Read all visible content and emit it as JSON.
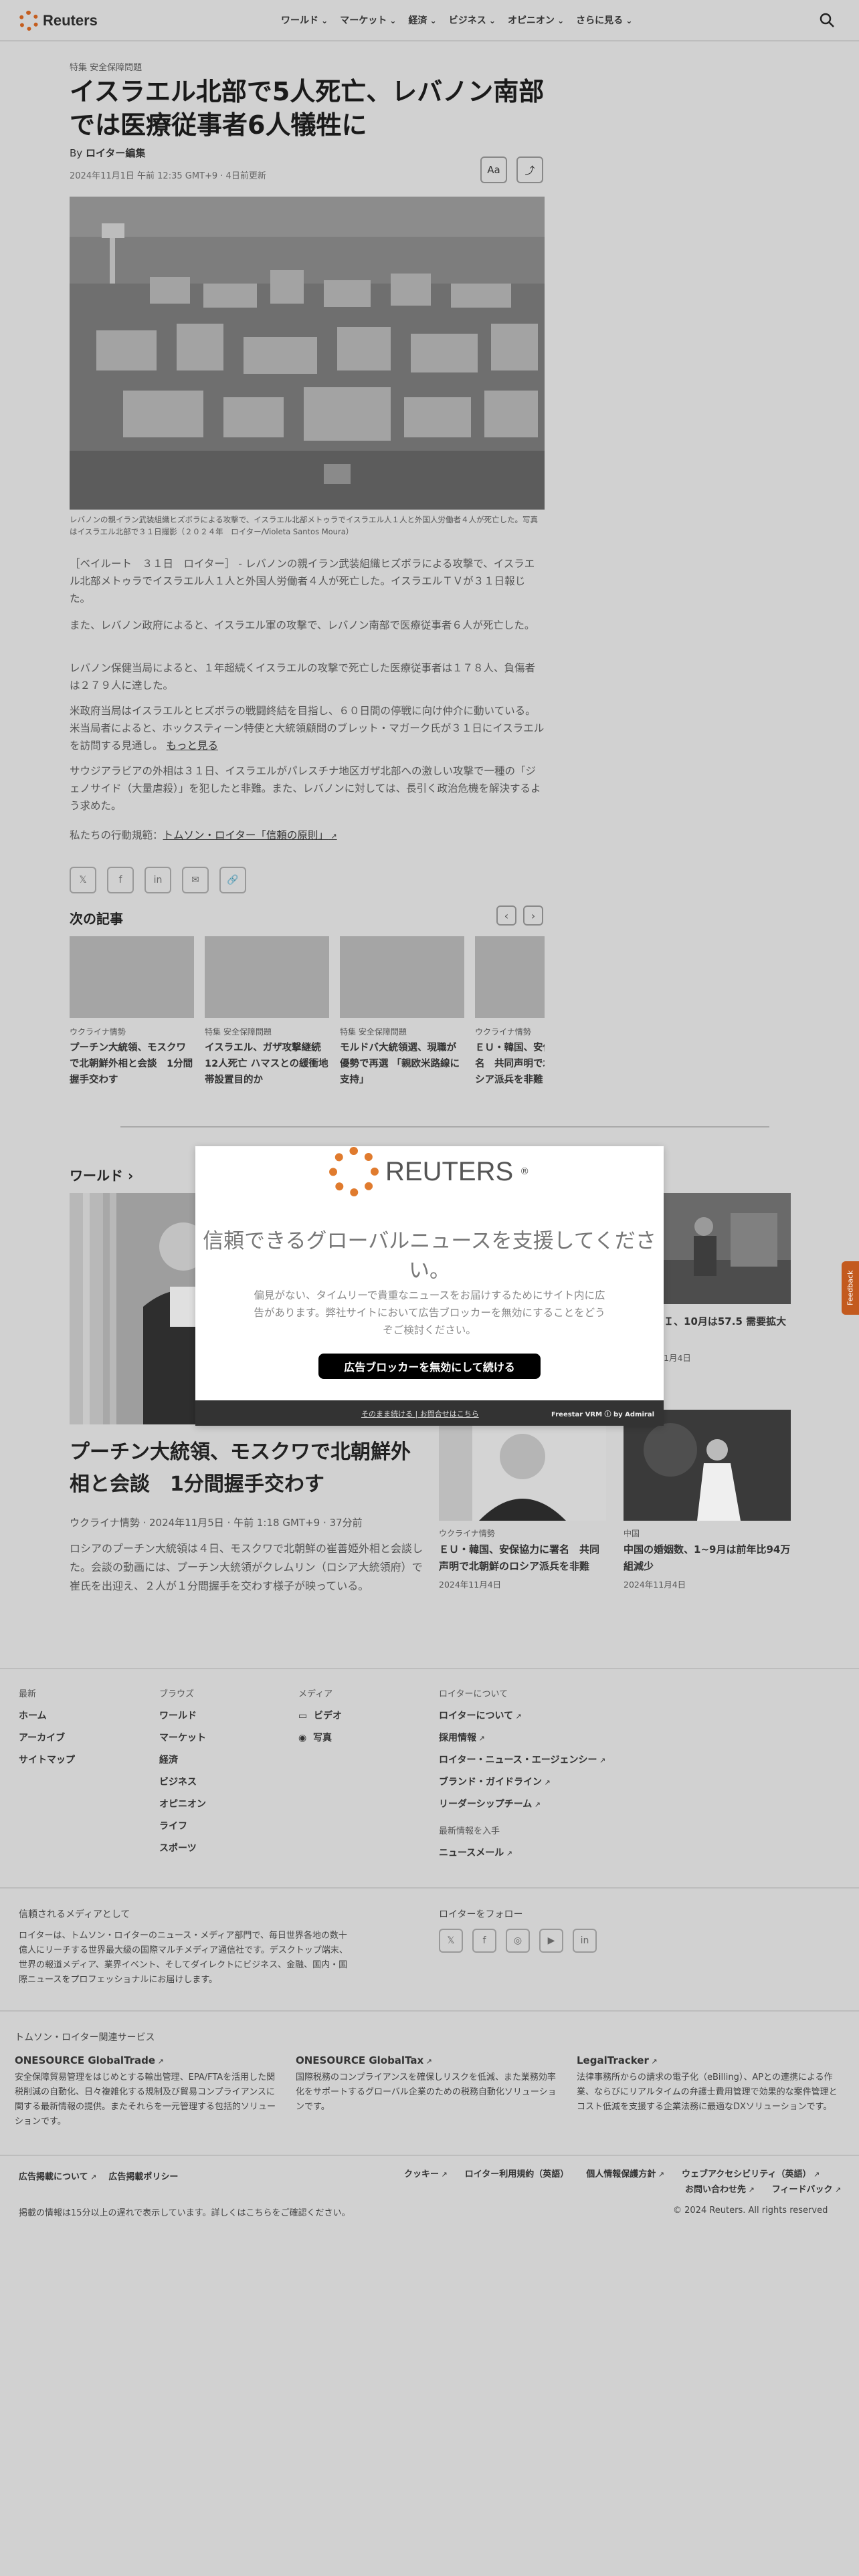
{
  "header": {
    "logo_text": "Reuters",
    "nav": [
      "ワールド",
      "マーケット",
      "経済",
      "ビジネス",
      "オピニオン",
      "さらに見る"
    ]
  },
  "article": {
    "kicker": "特集 安全保障問題",
    "title": "イスラエル北部で5人死亡、レバノン南部では医療従事者6人犠牲に",
    "byline_prefix": "By ",
    "byline_author": "ロイター編集",
    "date": "2024年11月1日 午前 12:35 GMT+9 · 4日前更新",
    "text_size_label": "Aa",
    "caption": "レバノンの親イラン武装組織ヒズボラによる攻撃で、イスラエル北部メトゥラでイスラエル人１人と外国人労働者４人が死亡した。写真はイスラエル北部で３１日撮影（２０２４年　ロイター/Violeta Santos Moura）",
    "paragraphs": [
      "［ベイルート　３１日　ロイター］ - レバノンの親イラン武装組織ヒズボラによる攻撃で、イスラエル北部メトゥラでイスラエル人１人と外国人労働者４人が死亡した。イスラエルＴＶが３１日報じた。",
      "また、レバノン政府によると、イスラエル軍の攻撃で、レバノン南部で医療従事者６人が死亡した。",
      "レバノン保健当局によると、１年超続くイスラエルの攻撃で死亡した医療従事者は１７８人、負傷者は２７９人に達した。",
      "米政府当局はイスラエルとヒズボラの戦闘終結を目指し、６０日間の停戦に向け仲介に動いている。米当局者によると、ホックスティーン特使と大統領顧問のブレット・マガーク氏が３１日にイスラエルを訪問する見通し。",
      "サウジアラビアの外相は３１日、イスラエルがパレスチナ地区ガザ北部への激しい攻撃で一種の「ジェノサイド（大量虐殺）」を犯したと非難。また、レバノンに対しては、長引く政治危機を解決するよう求めた。"
    ],
    "read_more": "もっと見る",
    "principles_prefix": "私たちの行動規範：",
    "principles_link": "トムソン・ロイター「信頼の原則」"
  },
  "share": {
    "x": "𝕏",
    "facebook": "f",
    "linkedin": "in",
    "email": "✉",
    "link": "🔗"
  },
  "next": {
    "heading": "次の記事",
    "cards": [
      {
        "kicker": "ウクライナ情勢",
        "title": "プーチン大統領、モスクワで北朝鮮外相と会談　1分間握手交わす"
      },
      {
        "kicker": "特集 安全保障問題",
        "title": "イスラエル、ガザ攻撃継続 12人死亡 ハマスとの緩衝地帯設置目的か"
      },
      {
        "kicker": "特集 安全保障問題",
        "title": "モルドバ大統領選、現職が優勢で再選 「親欧米路線に支持」"
      },
      {
        "kicker": "ウクライナ情勢",
        "title": "ＥＵ・韓国、安保協力に署名　共同声明で北朝鮮のロシア派兵を非難"
      }
    ]
  },
  "world": {
    "heading": "ワールド ›",
    "main_title": "プーチン大統領、モスクワで北朝鮮外相と会談　1分間握手交わす",
    "main_meta": "ウクライナ情勢 · 2024年11月5日 · 午前 1:18 GMT+9 · 37分前",
    "main_desc": "ロシアのプーチン大統領は４日、モスクワで北朝鮮の崔善姫外相と会談した。会談の動画には、プーチン大統領がクレムリン（ロシア大統領府）で崔氏を出迎え、２人が１分間握手を交わす様子が映っている。",
    "side": [
      {
        "kicker": "",
        "title": "造業ＰＭＩ、10月は57.5 需要拡大",
        "date": "1月4日"
      },
      {
        "kicker": "ウクライナ情勢",
        "title": "ＥＵ・韓国、安保協力に署名　共同声明で北朝鮮のロシア派兵を非難",
        "date": "2024年11月4日"
      },
      {
        "kicker": "中国",
        "title": "中国の婚姻数、1~9月は前年比94万組減少",
        "date": "2024年11月4日"
      }
    ]
  },
  "footer": {
    "latest": {
      "heading": "最新",
      "items": [
        "ホーム",
        "アーカイブ",
        "サイトマップ"
      ]
    },
    "browse": {
      "heading": "ブラウズ",
      "items": [
        "ワールド",
        "マーケット",
        "経済",
        "ビジネス",
        "オピニオン",
        "ライフ",
        "スポーツ"
      ]
    },
    "media": {
      "heading": "メディア",
      "items": [
        "ビデオ",
        "写真"
      ]
    },
    "about": {
      "heading": "ロイターについて",
      "items": [
        "ロイターについて",
        "採用情報",
        "ロイター・ニュース・エージェンシー",
        "ブランド・ガイドライン",
        "リーダーシップチーム"
      ]
    },
    "newsletter": {
      "heading": "最新情報を入手",
      "item": "ニュースメール"
    },
    "trusted_heading": "信頼されるメディアとして",
    "trusted_text": "ロイターは、トムソン・ロイターのニュース・メディア部門で、毎日世界各地の数十億人にリーチする世界最大級の国際マルチメディア通信社です。デスクトップ端末、世界の報道メディア、業界イベント、そしてダイレクトにビジネス、金融、国内・国際ニュースをプロフェッショナルにお届けします。",
    "follow_heading": "ロイターをフォロー",
    "follow_icons": [
      "𝕏",
      "f",
      "◎",
      "▶",
      "in"
    ],
    "services_heading": "トムソン・ロイター関連サービス",
    "services": [
      {
        "name": "ONESOURCE GlobalTrade",
        "text": "安全保障貿易管理をはじめとする輸出管理、EPA/FTAを活用した関税削減の自動化、日々複雑化する規制及び貿易コンプライアンスに関する最新情報の提供。またそれらを一元管理する包括的ソリューションです。"
      },
      {
        "name": "ONESOURCE GlobalTax",
        "text": "国際税務のコンプライアンスを確保しリスクを低減、また業務効率化をサポートするグローバル企業のための税務自動化ソリューションです。"
      },
      {
        "name": "LegalTracker",
        "text": "法律事務所からの請求の電子化（eBilling）、APとの連携による作業、ならびにリアルタイムの弁護士費用管理で効果的な案件管理とコスト低減を支援する企業法務に最適なDXソリューションです。"
      }
    ],
    "legal_left": [
      "広告掲載について",
      "広告掲載ポリシー"
    ],
    "legal_right": [
      "クッキー",
      "ロイター利用規約（英語）",
      "個人情報保護方針",
      "ウェブアクセシビリティ（英語）",
      "お問い合わせ先",
      "フィードバック"
    ],
    "delay_note": "掲載の情報は15分以上の遅れで表示しています。詳しくはこちらをご確認ください。",
    "copyright": "© 2024 Reuters. All rights reserved"
  },
  "modal": {
    "brand": "REUTERS",
    "heading": "信頼できるグローバルニュースを支援してください。",
    "body": "偏見がない、タイムリーで貴重なニュースをお届けするためにサイト内に広告があります。弊社サイトにおいて広告ブロッカーを無効にすることをどうぞご検討ください。",
    "button": "広告ブロッカーを無効にして続ける",
    "link_continue": "そのまま続ける",
    "link_sep": " | ",
    "link_why": "お問合せはこちら",
    "powered": "Freestar VRM ⓘ by Admiral"
  },
  "feedback": "Feedback"
}
